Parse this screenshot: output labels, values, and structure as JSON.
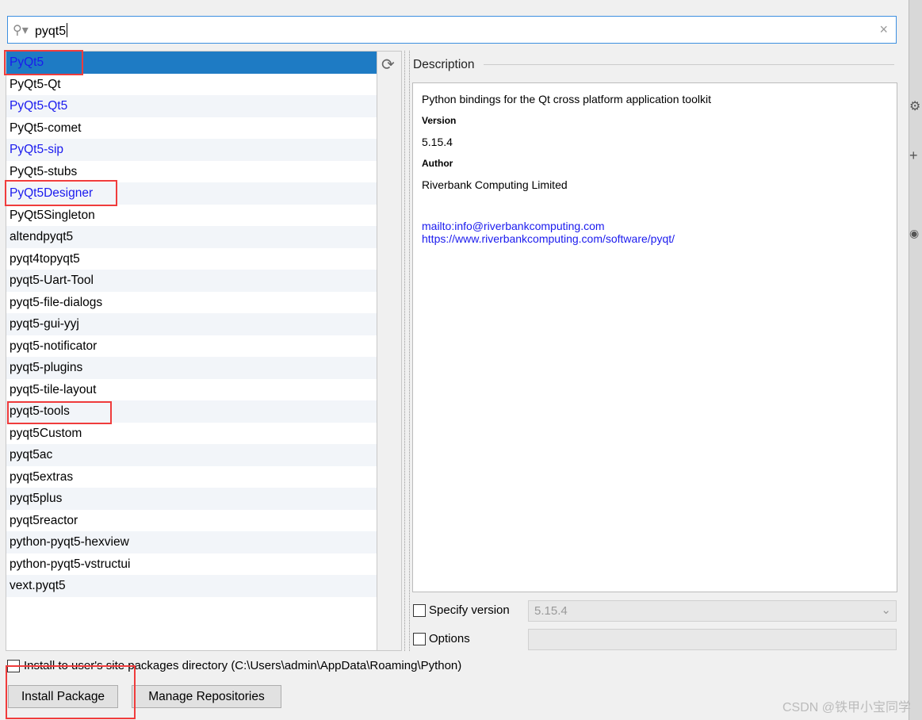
{
  "search": {
    "value": "pyqt5",
    "icon": "search-icon",
    "clear_icon": "close-icon"
  },
  "packages": [
    {
      "name": "PyQt5",
      "installed": true
    },
    {
      "name": "PyQt5-Qt",
      "installed": false
    },
    {
      "name": "PyQt5-Qt5",
      "installed": true
    },
    {
      "name": "PyQt5-comet",
      "installed": false
    },
    {
      "name": "PyQt5-sip",
      "installed": true
    },
    {
      "name": "PyQt5-stubs",
      "installed": false
    },
    {
      "name": "PyQt5Designer",
      "installed": true
    },
    {
      "name": "PyQt5Singleton",
      "installed": false
    },
    {
      "name": "altendpyqt5",
      "installed": false
    },
    {
      "name": "pyqt4topyqt5",
      "installed": false
    },
    {
      "name": "pyqt5-Uart-Tool",
      "installed": false
    },
    {
      "name": "pyqt5-file-dialogs",
      "installed": false
    },
    {
      "name": "pyqt5-gui-yyj",
      "installed": false
    },
    {
      "name": "pyqt5-notificator",
      "installed": false
    },
    {
      "name": "pyqt5-plugins",
      "installed": false
    },
    {
      "name": "pyqt5-tile-layout",
      "installed": false
    },
    {
      "name": "pyqt5-tools",
      "installed": false
    },
    {
      "name": "pyqt5Custom",
      "installed": false
    },
    {
      "name": "pyqt5ac",
      "installed": false
    },
    {
      "name": "pyqt5extras",
      "installed": false
    },
    {
      "name": "pyqt5plus",
      "installed": false
    },
    {
      "name": "pyqt5reactor",
      "installed": false
    },
    {
      "name": "python-pyqt5-hexview",
      "installed": false
    },
    {
      "name": "python-pyqt5-vstructui",
      "installed": false
    },
    {
      "name": "vext.pyqt5",
      "installed": false
    }
  ],
  "selected_index": 0,
  "description": {
    "label": "Description",
    "summary": "Python bindings for the Qt cross platform application toolkit",
    "version_label": "Version",
    "version": "5.15.4",
    "author_label": "Author",
    "author": "Riverbank Computing Limited",
    "email_link": "mailto:info@riverbankcomputing.com",
    "web_link": "https://www.riverbankcomputing.com/software/pyqt/"
  },
  "options": {
    "specify_version_label": "Specify version",
    "specify_version_value": "5.15.4",
    "options_label": "Options",
    "install_user_label": "Install to user's site packages directory (C:\\Users\\admin\\AppData\\Roaming\\Python)"
  },
  "buttons": {
    "install": "Install Package",
    "manage": "Manage Repositories"
  },
  "watermark": "CSDN @铁甲小宝同学"
}
